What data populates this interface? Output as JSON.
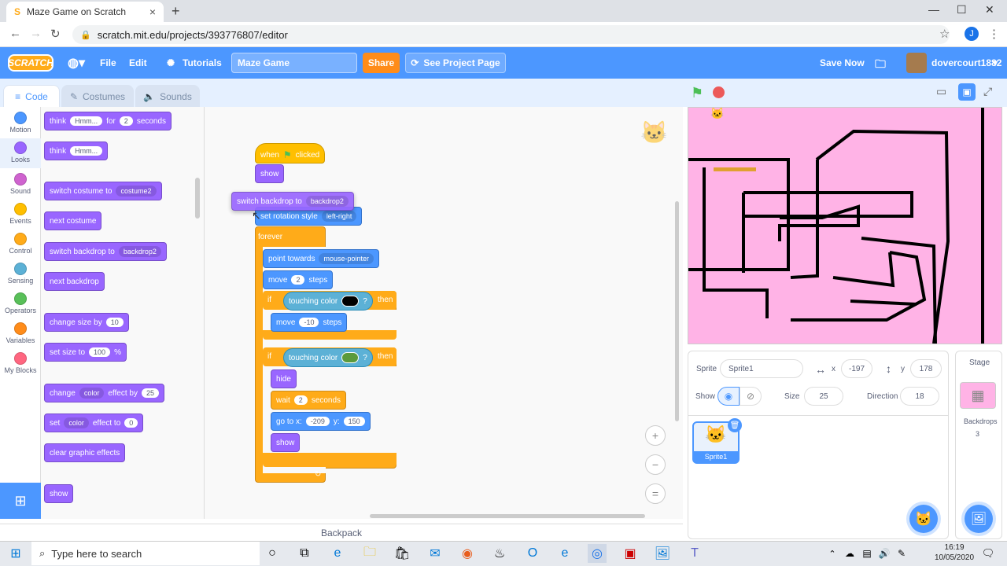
{
  "browser": {
    "tab_title": "Maze Game on Scratch",
    "url": "scratch.mit.edu/projects/393776807/editor",
    "profile_initial": "J"
  },
  "menubar": {
    "logo": "SCRATCH",
    "file": "File",
    "edit": "Edit",
    "tutorials": "Tutorials",
    "project_title": "Maze Game",
    "share": "Share",
    "see_project_page": "See Project Page",
    "save_now": "Save Now",
    "username": "dovercourt1882"
  },
  "editor_tabs": {
    "code": "Code",
    "costumes": "Costumes",
    "sounds": "Sounds"
  },
  "categories": [
    {
      "label": "Motion",
      "color": "#4c97ff"
    },
    {
      "label": "Looks",
      "color": "#9966ff"
    },
    {
      "label": "Sound",
      "color": "#cf63cf"
    },
    {
      "label": "Events",
      "color": "#ffbf00"
    },
    {
      "label": "Control",
      "color": "#ffab19"
    },
    {
      "label": "Sensing",
      "color": "#5cb1d6"
    },
    {
      "label": "Operators",
      "color": "#59c059"
    },
    {
      "label": "Variables",
      "color": "#ff8c1a"
    },
    {
      "label": "My Blocks",
      "color": "#ff6680"
    }
  ],
  "palette": {
    "think_for": {
      "a": "think",
      "b": "Hmm...",
      "c": "for",
      "d": "2",
      "e": "seconds"
    },
    "think": {
      "a": "think",
      "b": "Hmm..."
    },
    "switch_costume": {
      "a": "switch costume to",
      "b": "costume2"
    },
    "next_costume": "next costume",
    "switch_backdrop": {
      "a": "switch backdrop to",
      "b": "backdrop2"
    },
    "next_backdrop": "next backdrop",
    "change_size": {
      "a": "change size by",
      "b": "10"
    },
    "set_size": {
      "a": "set size to",
      "b": "100",
      "c": "%"
    },
    "change_effect": {
      "a": "change",
      "b": "color",
      "c": "effect by",
      "d": "25"
    },
    "set_effect": {
      "a": "set",
      "b": "color",
      "c": "effect to",
      "d": "0"
    },
    "clear_effects": "clear graphic effects",
    "show": "show"
  },
  "script": {
    "when_clicked": {
      "a": "when",
      "b": "clicked"
    },
    "show": "show",
    "dragging": {
      "a": "switch backdrop to",
      "b": "backdrop2"
    },
    "rotation": {
      "a": "set rotation style",
      "b": "left-right"
    },
    "forever": "forever",
    "point": {
      "a": "point towards",
      "b": "mouse-pointer"
    },
    "move": {
      "a": "move",
      "b": "2",
      "c": "steps"
    },
    "if1": {
      "a": "if",
      "b": "touching color",
      "c": "?",
      "d": "then",
      "color": "#000000"
    },
    "move_back": {
      "a": "move",
      "b": "-10",
      "c": "steps"
    },
    "if2": {
      "a": "if",
      "b": "touching color",
      "c": "?",
      "d": "then",
      "color": "#5b9a3c"
    },
    "hide": "hide",
    "wait": {
      "a": "wait",
      "b": "2",
      "c": "seconds"
    },
    "goto": {
      "a": "go to x:",
      "b": "-209",
      "c": "y:",
      "d": "150"
    },
    "show2": "show"
  },
  "sprite_info": {
    "sprite_label": "Sprite",
    "sprite_name": "Sprite1",
    "x_label": "x",
    "x_value": "-197",
    "y_label": "y",
    "y_value": "178",
    "show_label": "Show",
    "size_label": "Size",
    "size_value": "25",
    "direction_label": "Direction",
    "direction_value": "18"
  },
  "sprite_tile": "Sprite1",
  "stage_pane": {
    "title": "Stage",
    "backdrops_label": "Backdrops",
    "backdrops_count": "3"
  },
  "backpack": "Backpack",
  "taskbar": {
    "search_placeholder": "Type here to search",
    "time": "16:19",
    "date": "10/05/2020"
  }
}
